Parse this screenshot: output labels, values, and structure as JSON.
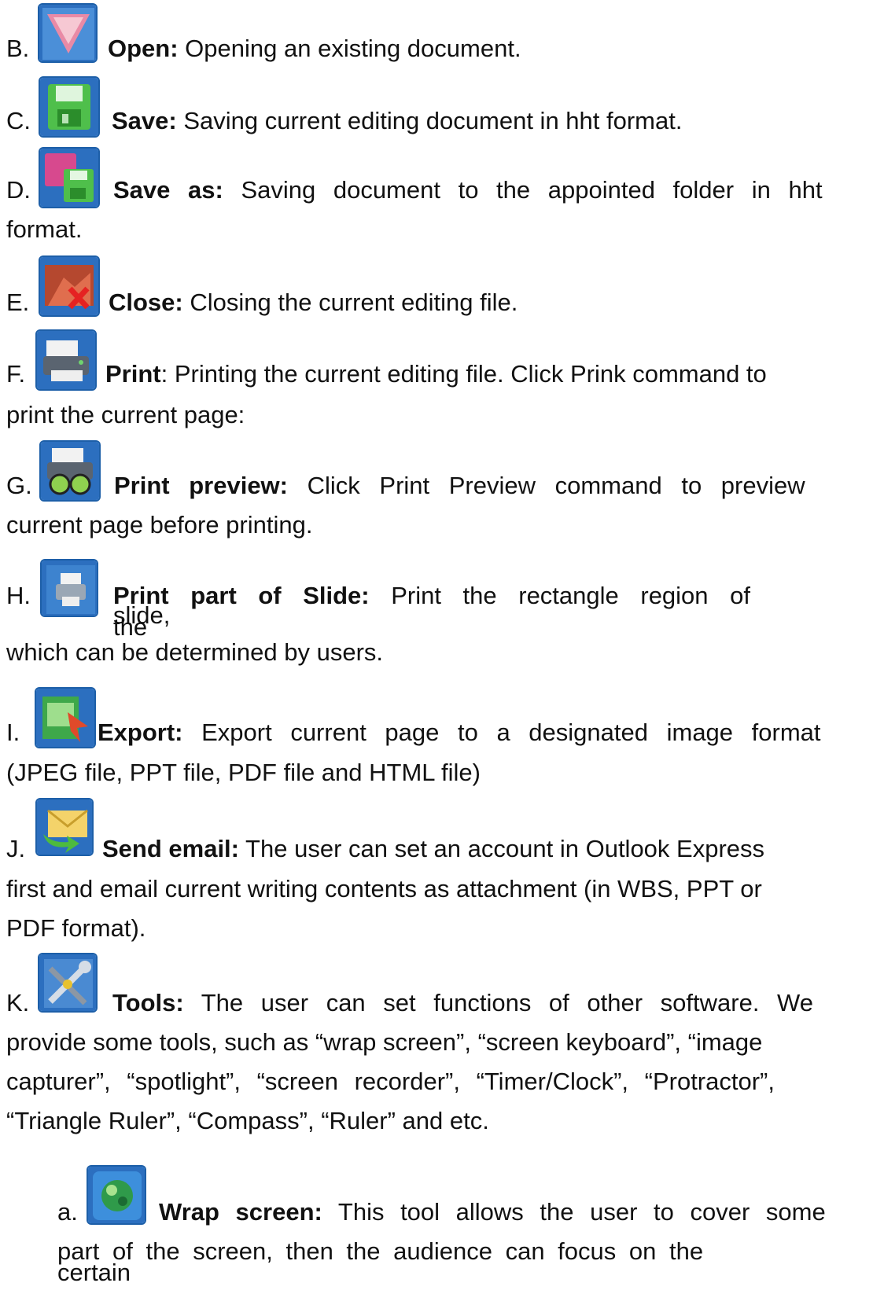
{
  "items": [
    {
      "letter": "B.",
      "icon": "open-icon",
      "title": "Open:",
      "desc": " Opening an existing document."
    },
    {
      "letter": "C.",
      "icon": "save-icon",
      "title": "Save:",
      "desc": " Saving current editing document in hht format."
    },
    {
      "letter": "D.",
      "icon": "save-as-icon",
      "title": "Save as:",
      "desc": " Saving document to the appointed folder in hht",
      "cont": "format."
    },
    {
      "letter": "E.",
      "icon": "close-file-icon",
      "title": "Close:",
      "desc": " Closing the current editing file."
    },
    {
      "letter": "F.",
      "icon": "print-icon",
      "title": "Print",
      "desc": ": Printing the current editing file. Click Prink command to",
      "cont": "print the current page:"
    },
    {
      "letter": "G.",
      "icon": "print-preview-icon",
      "title": "Print preview:",
      "desc": " Click Print Preview command to preview",
      "cont": "current page before printing."
    },
    {
      "letter": "H.",
      "icon": "print-part-icon",
      "title": "Print part of Slide:",
      "desc": " Print the rectangle region of the",
      "wrap": "slide,",
      "cont": "which can be determined by users."
    },
    {
      "letter": "I.",
      "icon": "export-icon",
      "title": "Export:",
      "desc": " Export current page to a designated image format",
      "cont": "(JPEG file, PPT file, PDF file and HTML file)"
    },
    {
      "letter": "J.",
      "icon": "email-icon",
      "title": "Send email:",
      "desc": " The user can set an account in Outlook Express",
      "cont": "first and email current writing contents as attachment (in WBS, PPT or",
      "cont2": "PDF format)."
    },
    {
      "letter": "K.",
      "icon": "tools-icon",
      "title": "Tools:",
      "desc": " The user can set functions of other software. We",
      "cont": "provide some tools, such as “wrap screen”, “screen keyboard”, “image",
      "cont2": "capturer”, “spotlight”, “screen recorder”, “Timer/Clock”, “Protractor”,",
      "cont3": "“Triangle Ruler”, “Compass”, “Ruler” and etc."
    },
    {
      "letter": "a.",
      "icon": "wrap-screen-icon",
      "title": "Wrap screen:",
      "desc": " This tool allows the user to cover some",
      "cont": "part of the screen, then the audience can focus on the",
      "wrap": "certain"
    }
  ]
}
